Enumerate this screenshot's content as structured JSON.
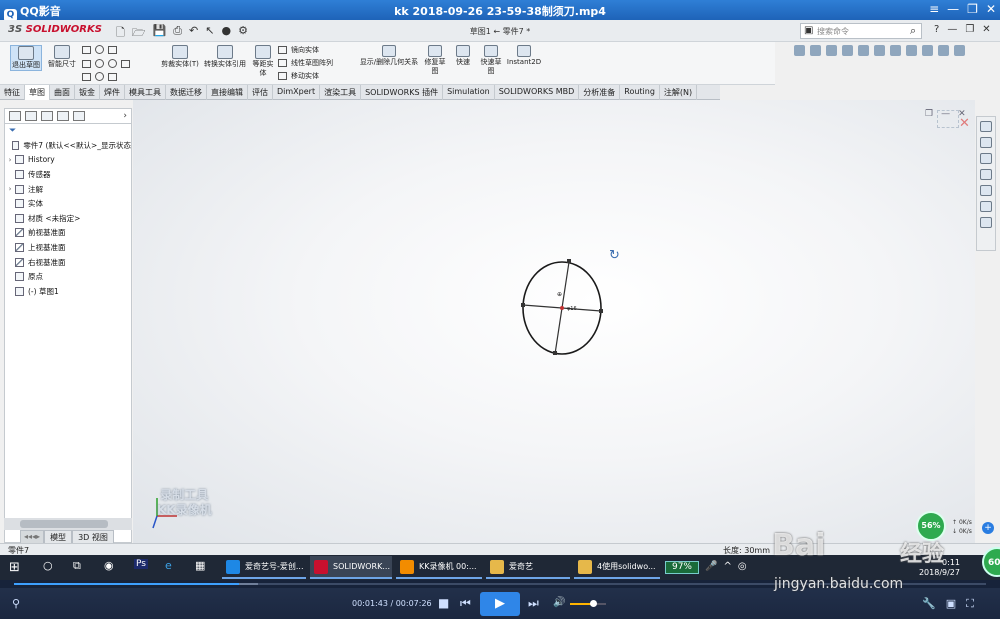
{
  "player": {
    "app_name": "QQ影音",
    "title": "kk 2018-09-26 23-59-38制须刀.mp4",
    "window_buttons": [
      "≡",
      "—",
      "❐",
      "✕"
    ]
  },
  "solidworks": {
    "logo": "SOLIDWORKS",
    "logo_prefix": "3S",
    "doc_title": "草图1 ← 零件7 *",
    "search_placeholder": "搜索命令",
    "help_buttons": [
      "?",
      "—",
      "❐",
      "✕"
    ],
    "ribbon": {
      "exit_sketch": "退出草图",
      "smart_dim": "智能尺寸",
      "trim": "剪裁实体(T)",
      "convert": "转换实体引用",
      "offset": "等距实体",
      "mirror": "镜向实体",
      "linear_pattern": "线性草图阵列",
      "move": "移动实体",
      "relations": "显示/删除几何关系",
      "repair": "修复草图",
      "quick_snaps": "快速",
      "rapid_sketch": "快速草图",
      "instant2d": "Instant2D"
    },
    "tabs": [
      "特征",
      "草图",
      "曲面",
      "钣金",
      "焊件",
      "模具工具",
      "数据迁移",
      "直接编辑",
      "评估",
      "DimXpert",
      "渲染工具",
      "SOLIDWORKS 插件",
      "Simulation",
      "SOLIDWORKS MBD",
      "分析准备",
      "Routing",
      "注解(N)"
    ],
    "active_tab": 1,
    "tree": [
      {
        "label": "零件7 (默认<<默认>_显示状态",
        "expand": "",
        "icon": "part"
      },
      {
        "label": "History",
        "expand": "›",
        "icon": "folder"
      },
      {
        "label": "传感器",
        "expand": "",
        "icon": "sensor"
      },
      {
        "label": "注解",
        "expand": "›",
        "icon": "annot"
      },
      {
        "label": "实体",
        "expand": "",
        "icon": "solid"
      },
      {
        "label": "材质 <未指定>",
        "expand": "",
        "icon": "material"
      },
      {
        "label": "前视基准面",
        "expand": "",
        "icon": "plane"
      },
      {
        "label": "上视基准面",
        "expand": "",
        "icon": "plane"
      },
      {
        "label": "右视基准面",
        "expand": "",
        "icon": "plane"
      },
      {
        "label": "原点",
        "expand": "",
        "icon": "origin"
      },
      {
        "label": "(-) 草图1",
        "expand": "",
        "icon": "sketch"
      }
    ],
    "model_tabs": [
      "模型",
      "3D 视图"
    ],
    "watermark": [
      "录制工具",
      "KK录像机"
    ],
    "status_left": "零件7",
    "status_right": "长度: 30mm",
    "sketch_dim": "φ16",
    "net_speed": {
      "percent": "56%",
      "up": "0K/s",
      "down": "0K/s"
    }
  },
  "taskbar": {
    "apps": [
      {
        "label": "爱奇艺号-爱创...",
        "color": "#1e88e5"
      },
      {
        "label": "SOLIDWORK...",
        "color": "#c8102e"
      },
      {
        "label": "KK录像机 00:...",
        "color": "#f28c00"
      },
      {
        "label": "爱奇艺",
        "color": "#e6b84a"
      },
      {
        "label": "4使用solidwo...",
        "color": "#e6b84a"
      }
    ],
    "battery": "97%",
    "clock_time": "0:11",
    "clock_date": "2018/9/27",
    "corner_badge": "60"
  },
  "controls": {
    "time": "00:01:43 / 00:07:26",
    "progress": 0.231,
    "volume": 0.65
  },
  "baidu": {
    "logo": "Bai",
    "logo2": "经验",
    "url": "jingyan.baidu.com"
  }
}
